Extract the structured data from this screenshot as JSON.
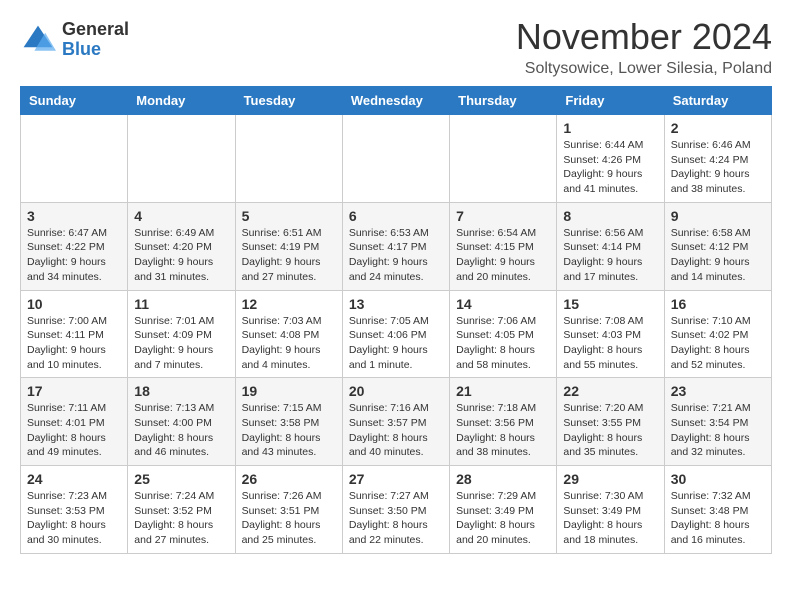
{
  "logo": {
    "general": "General",
    "blue": "Blue"
  },
  "title": "November 2024",
  "subtitle": "Soltysowice, Lower Silesia, Poland",
  "days_of_week": [
    "Sunday",
    "Monday",
    "Tuesday",
    "Wednesday",
    "Thursday",
    "Friday",
    "Saturday"
  ],
  "weeks": [
    [
      {
        "day": "",
        "info": ""
      },
      {
        "day": "",
        "info": ""
      },
      {
        "day": "",
        "info": ""
      },
      {
        "day": "",
        "info": ""
      },
      {
        "day": "",
        "info": ""
      },
      {
        "day": "1",
        "info": "Sunrise: 6:44 AM\nSunset: 4:26 PM\nDaylight: 9 hours and 41 minutes."
      },
      {
        "day": "2",
        "info": "Sunrise: 6:46 AM\nSunset: 4:24 PM\nDaylight: 9 hours and 38 minutes."
      }
    ],
    [
      {
        "day": "3",
        "info": "Sunrise: 6:47 AM\nSunset: 4:22 PM\nDaylight: 9 hours and 34 minutes."
      },
      {
        "day": "4",
        "info": "Sunrise: 6:49 AM\nSunset: 4:20 PM\nDaylight: 9 hours and 31 minutes."
      },
      {
        "day": "5",
        "info": "Sunrise: 6:51 AM\nSunset: 4:19 PM\nDaylight: 9 hours and 27 minutes."
      },
      {
        "day": "6",
        "info": "Sunrise: 6:53 AM\nSunset: 4:17 PM\nDaylight: 9 hours and 24 minutes."
      },
      {
        "day": "7",
        "info": "Sunrise: 6:54 AM\nSunset: 4:15 PM\nDaylight: 9 hours and 20 minutes."
      },
      {
        "day": "8",
        "info": "Sunrise: 6:56 AM\nSunset: 4:14 PM\nDaylight: 9 hours and 17 minutes."
      },
      {
        "day": "9",
        "info": "Sunrise: 6:58 AM\nSunset: 4:12 PM\nDaylight: 9 hours and 14 minutes."
      }
    ],
    [
      {
        "day": "10",
        "info": "Sunrise: 7:00 AM\nSunset: 4:11 PM\nDaylight: 9 hours and 10 minutes."
      },
      {
        "day": "11",
        "info": "Sunrise: 7:01 AM\nSunset: 4:09 PM\nDaylight: 9 hours and 7 minutes."
      },
      {
        "day": "12",
        "info": "Sunrise: 7:03 AM\nSunset: 4:08 PM\nDaylight: 9 hours and 4 minutes."
      },
      {
        "day": "13",
        "info": "Sunrise: 7:05 AM\nSunset: 4:06 PM\nDaylight: 9 hours and 1 minute."
      },
      {
        "day": "14",
        "info": "Sunrise: 7:06 AM\nSunset: 4:05 PM\nDaylight: 8 hours and 58 minutes."
      },
      {
        "day": "15",
        "info": "Sunrise: 7:08 AM\nSunset: 4:03 PM\nDaylight: 8 hours and 55 minutes."
      },
      {
        "day": "16",
        "info": "Sunrise: 7:10 AM\nSunset: 4:02 PM\nDaylight: 8 hours and 52 minutes."
      }
    ],
    [
      {
        "day": "17",
        "info": "Sunrise: 7:11 AM\nSunset: 4:01 PM\nDaylight: 8 hours and 49 minutes."
      },
      {
        "day": "18",
        "info": "Sunrise: 7:13 AM\nSunset: 4:00 PM\nDaylight: 8 hours and 46 minutes."
      },
      {
        "day": "19",
        "info": "Sunrise: 7:15 AM\nSunset: 3:58 PM\nDaylight: 8 hours and 43 minutes."
      },
      {
        "day": "20",
        "info": "Sunrise: 7:16 AM\nSunset: 3:57 PM\nDaylight: 8 hours and 40 minutes."
      },
      {
        "day": "21",
        "info": "Sunrise: 7:18 AM\nSunset: 3:56 PM\nDaylight: 8 hours and 38 minutes."
      },
      {
        "day": "22",
        "info": "Sunrise: 7:20 AM\nSunset: 3:55 PM\nDaylight: 8 hours and 35 minutes."
      },
      {
        "day": "23",
        "info": "Sunrise: 7:21 AM\nSunset: 3:54 PM\nDaylight: 8 hours and 32 minutes."
      }
    ],
    [
      {
        "day": "24",
        "info": "Sunrise: 7:23 AM\nSunset: 3:53 PM\nDaylight: 8 hours and 30 minutes."
      },
      {
        "day": "25",
        "info": "Sunrise: 7:24 AM\nSunset: 3:52 PM\nDaylight: 8 hours and 27 minutes."
      },
      {
        "day": "26",
        "info": "Sunrise: 7:26 AM\nSunset: 3:51 PM\nDaylight: 8 hours and 25 minutes."
      },
      {
        "day": "27",
        "info": "Sunrise: 7:27 AM\nSunset: 3:50 PM\nDaylight: 8 hours and 22 minutes."
      },
      {
        "day": "28",
        "info": "Sunrise: 7:29 AM\nSunset: 3:49 PM\nDaylight: 8 hours and 20 minutes."
      },
      {
        "day": "29",
        "info": "Sunrise: 7:30 AM\nSunset: 3:49 PM\nDaylight: 8 hours and 18 minutes."
      },
      {
        "day": "30",
        "info": "Sunrise: 7:32 AM\nSunset: 3:48 PM\nDaylight: 8 hours and 16 minutes."
      }
    ]
  ]
}
